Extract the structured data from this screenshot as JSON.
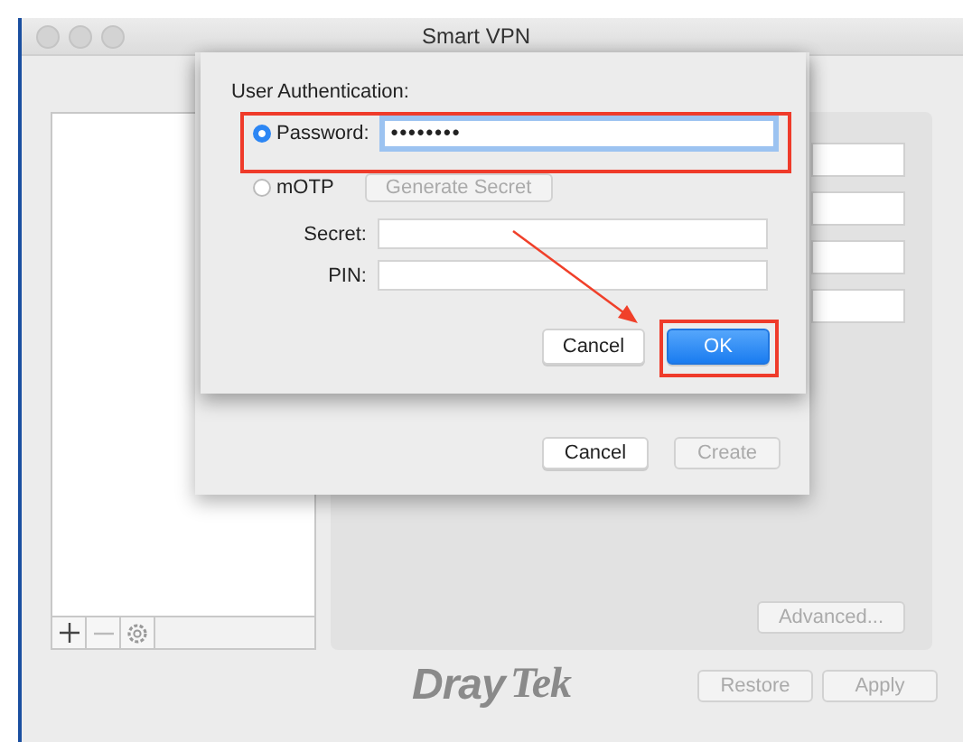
{
  "window": {
    "title": "Smart VPN"
  },
  "profile_list": {
    "toolbar": [
      {
        "kind": "add",
        "disabled": false
      },
      {
        "kind": "remove",
        "disabled": true
      },
      {
        "kind": "settings",
        "disabled": false
      }
    ]
  },
  "profile_panel": {
    "advanced_button": {
      "label": "Advanced...",
      "disabled": true
    }
  },
  "logo": {
    "part_1": "Dray",
    "part_2": "Tek"
  },
  "footer_buttons": [
    {
      "label": "Restore",
      "disabled": true
    },
    {
      "label": "Apply",
      "disabled": true
    }
  ],
  "create_sheet": {
    "buttons": [
      {
        "label": "Cancel",
        "disabled": false
      },
      {
        "label": "Create",
        "disabled": true
      }
    ]
  },
  "auth_dialog": {
    "heading": "User Authentication:",
    "options": [
      {
        "label": "Password:",
        "selected": true
      },
      {
        "label": "mOTP",
        "selected": false
      }
    ],
    "password_value": "••••••••",
    "generate_button": {
      "label": "Generate Secret",
      "disabled": true
    },
    "fields": [
      {
        "label": "Secret:"
      },
      {
        "label": "PIN:"
      }
    ],
    "buttons": [
      {
        "label": "Cancel",
        "disabled": false,
        "primary": false
      },
      {
        "label": "OK",
        "disabled": false,
        "primary": true
      }
    ]
  },
  "annotations": {
    "password_highlight": true,
    "ok_highlight": true,
    "arrow": true
  }
}
